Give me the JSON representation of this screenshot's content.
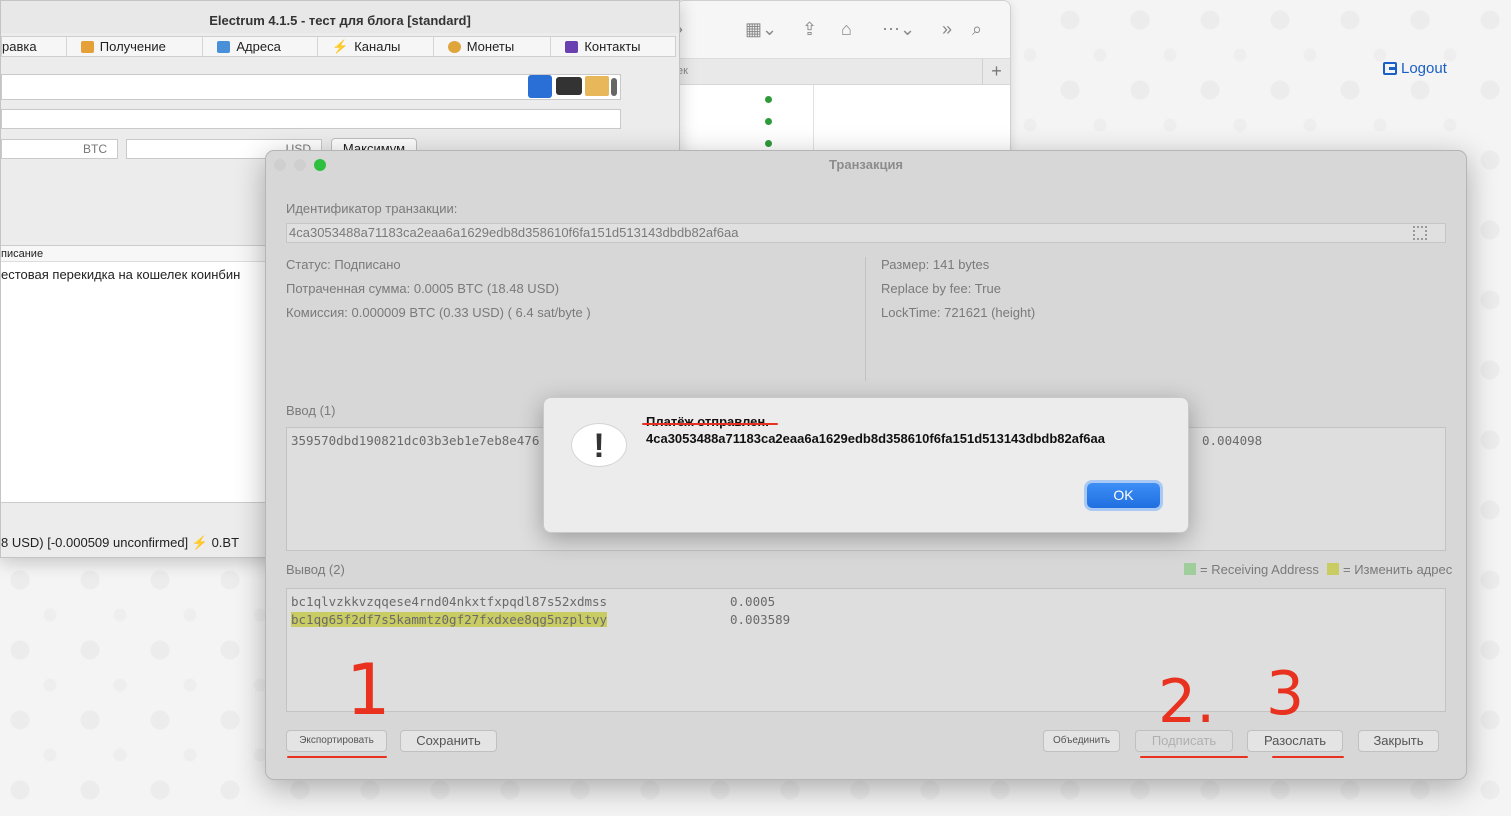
{
  "logout_label": "Logout",
  "electrum": {
    "title": "Electrum 4.1.5  -  тест для блога  [standard]",
    "tabs": [
      "равка",
      "Получение",
      "Адреса",
      "Каналы",
      "Монеты",
      "Контакты"
    ],
    "amount_unit": "BTC",
    "fiat_unit": "USD",
    "max_button": "Максимум",
    "history_header": "писание",
    "history_row": "естовая перекидка на кошелек коинбин",
    "status": "8 USD)  [-0.000509 unconfirmed]    ⚡ 0.BT"
  },
  "browser": {
    "tab_label": "ек"
  },
  "tx": {
    "title": "Транзакция",
    "id_label": "Идентификатор транзакции:",
    "txid": "4ca3053488a71183ca2eaa6a1629edb8d358610f6fa151d513143dbdb82af6aa",
    "status": "Статус: Подписано",
    "amount_sent": "Потраченная сумма: 0.0005 BTC (18.48 USD)",
    "fee": "Комиссия: 0.000009 BTC (0.33 USD)  ( 6.4 sat/byte )",
    "size": "Размер: 141 bytes",
    "rbf": "Replace by fee: True",
    "locktime": "LockTime: 721621 (height)",
    "inputs_label": "Ввод (1)",
    "input_txid": "359570dbd190821dc03b3eb1e7eb8e476",
    "input_amount": "0.004098",
    "outputs_label": "Вывод (2)",
    "legend_receiving": "= Receiving Address",
    "legend_change": "= Изменить адрес",
    "outputs": [
      {
        "address": "bc1qlvzkkvzqqese4rnd04nkxtfxpqdl87s52xdmss",
        "amount": "0.0005"
      },
      {
        "address": "bc1qg65f2df7s5kammtz0gf27fxdxee8qg5nzpltvy",
        "amount": "0.003589"
      }
    ],
    "buttons": {
      "export": "Экспортировать",
      "save": "Сохранить",
      "combine": "Объединить",
      "sign": "Подписать",
      "broadcast": "Разослать",
      "close": "Закрыть"
    }
  },
  "alert": {
    "line1": "Платёж отправлен.",
    "line2": "4ca3053488a71183ca2eaa6a1629edb8d358610f6fa151d513143dbdb82af6aa",
    "ok": "OK"
  },
  "annotations": [
    "1",
    "2.",
    "3"
  ],
  "colors": {
    "accent": "#1f6fe0",
    "annotation": "#e8321f",
    "change_highlight": "#c9cb63",
    "receiving_legend": "#9fce9c"
  }
}
